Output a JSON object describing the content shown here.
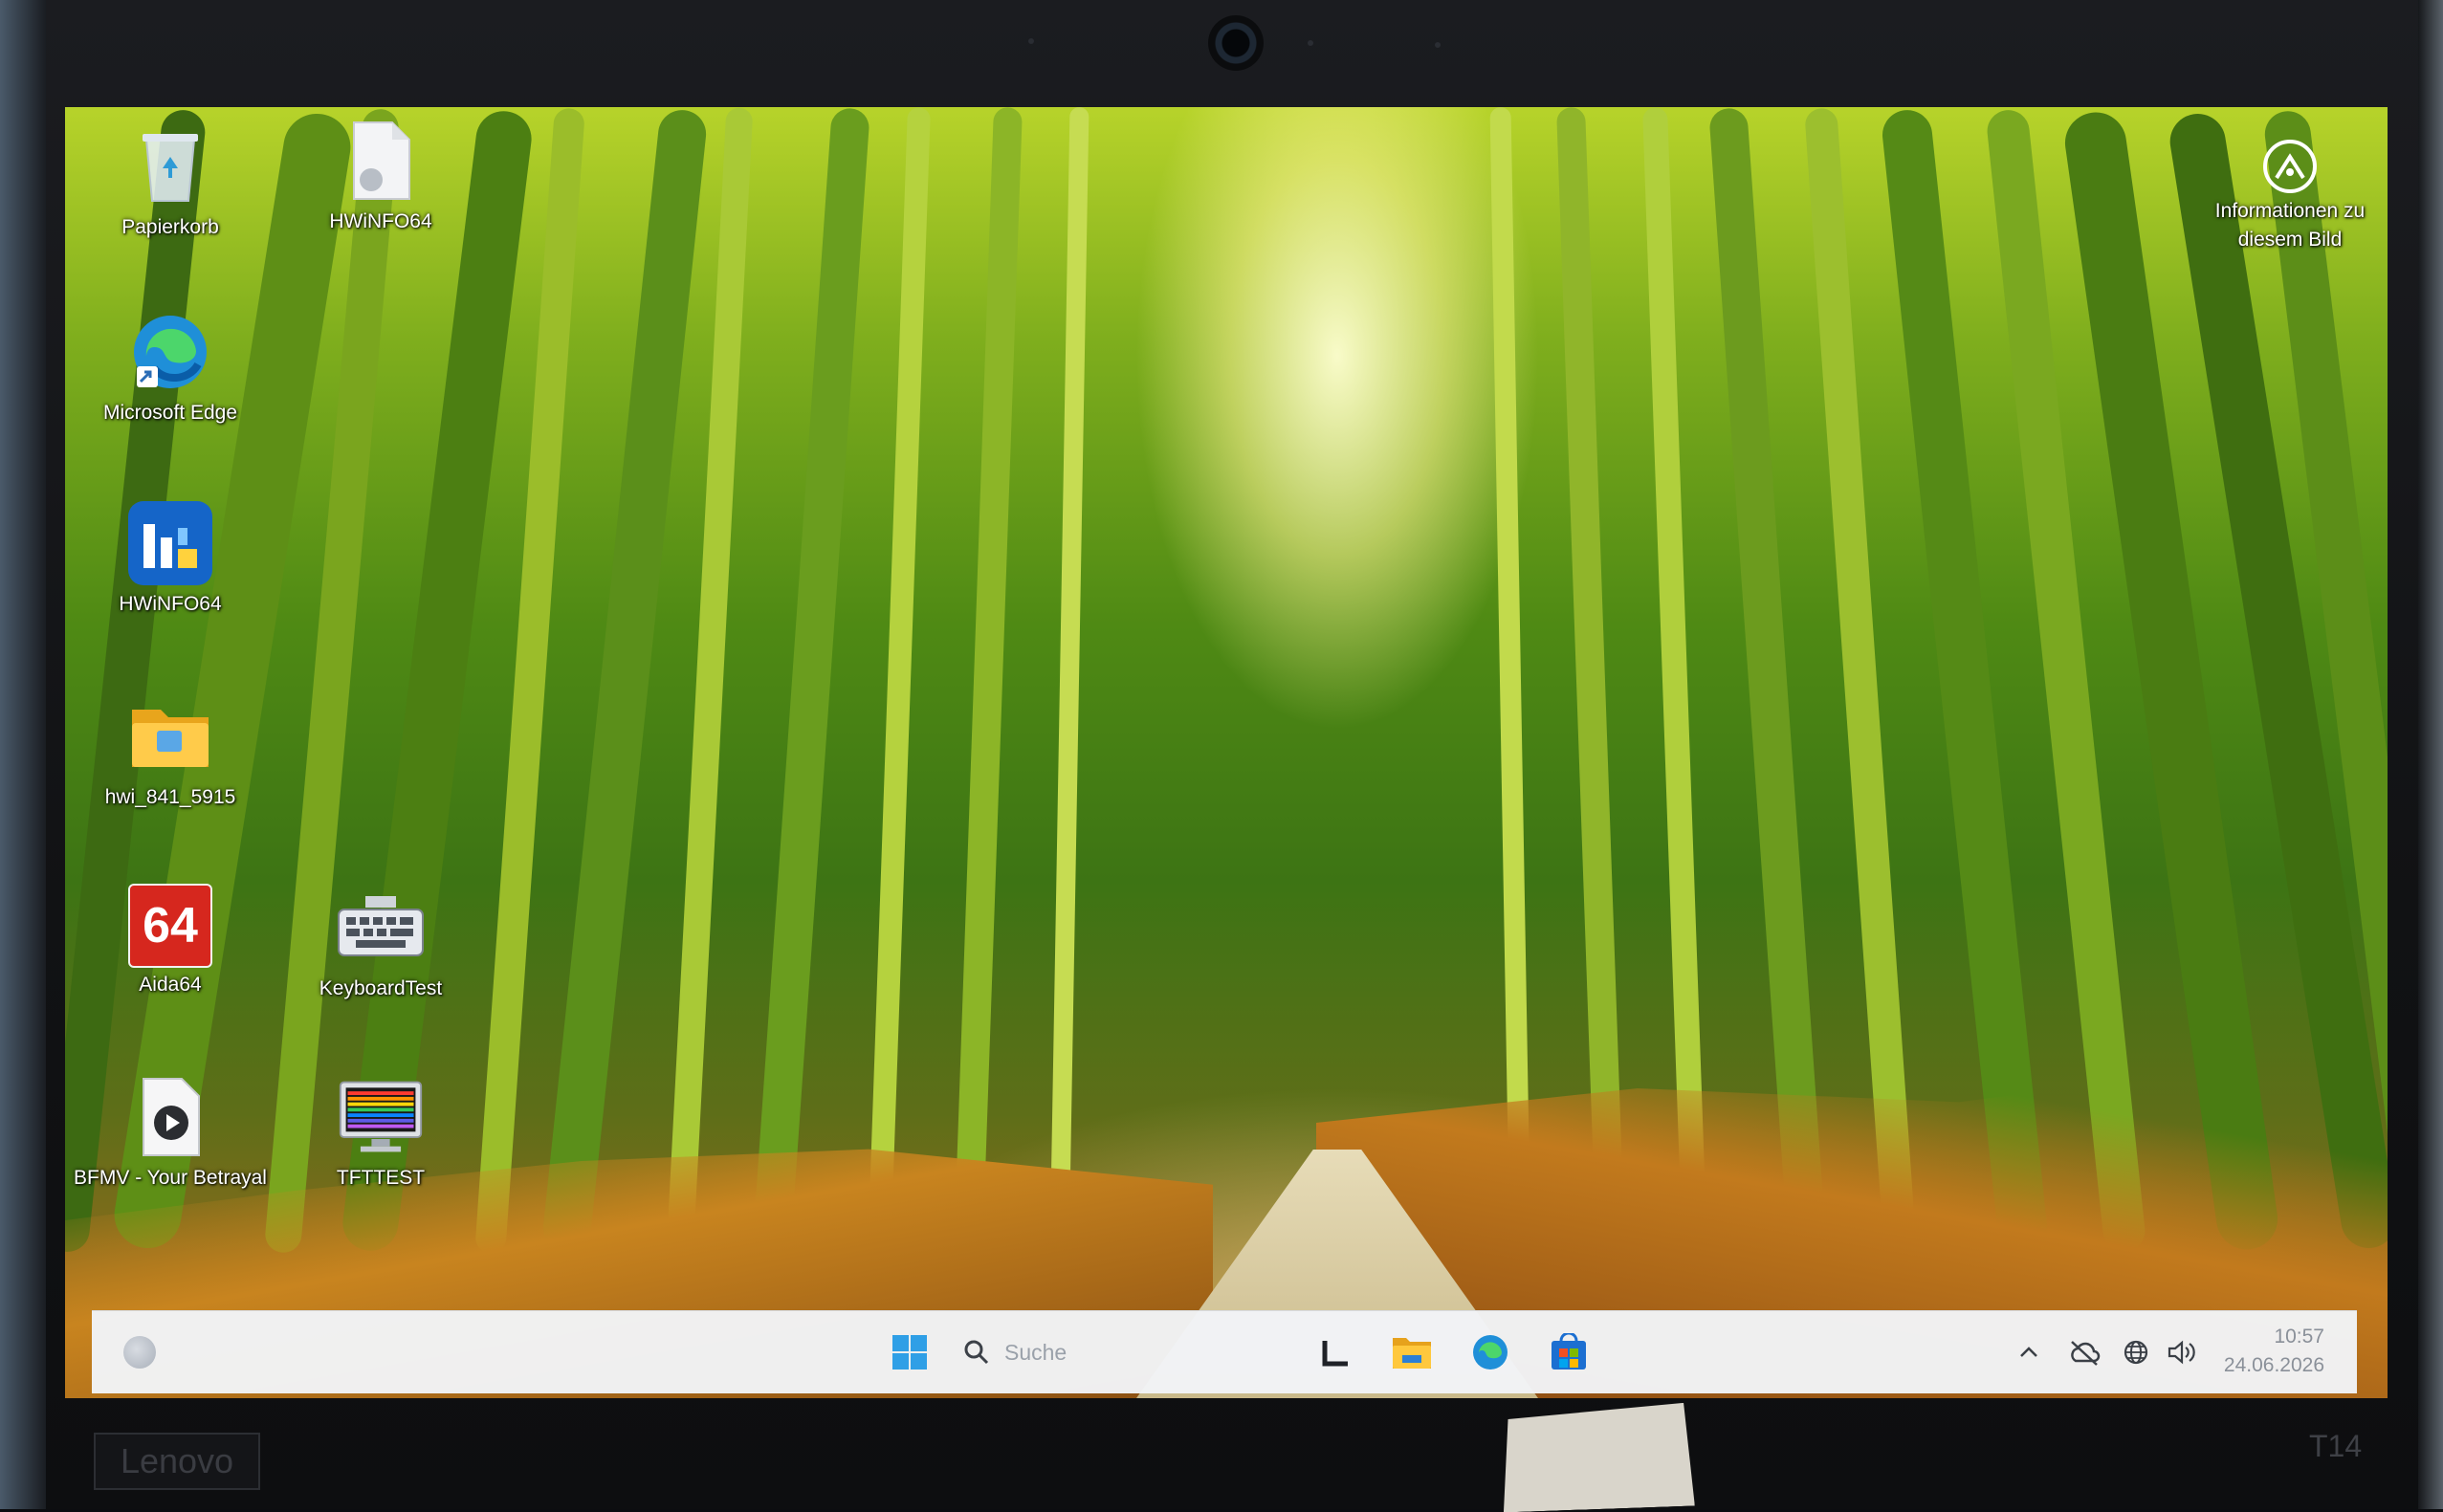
{
  "desktop": {
    "icons": [
      {
        "label": "Papierkorb",
        "icon": "recycle-bin-icon"
      },
      {
        "label": "HWiNFO64",
        "icon": "file-shortcut-icon"
      },
      {
        "label": "Microsoft Edge",
        "icon": "edge-icon"
      },
      {
        "label": "HWiNFO64",
        "icon": "hwinfo-icon"
      },
      {
        "label": "hwi_841_5915",
        "icon": "folder-icon"
      },
      {
        "label": "Aida64",
        "icon": "aida64-icon"
      },
      {
        "label": "KeyboardTest",
        "icon": "keyboard-icon"
      },
      {
        "label": "BFMV - Your Betrayal",
        "icon": "video-file-icon"
      },
      {
        "label": "TFTTEST",
        "icon": "monitor-test-icon"
      }
    ],
    "aida_badge": "64",
    "info_widget": {
      "line1": "Informationen zu",
      "line2": "diesem Bild",
      "icon": "spotlight-info-icon"
    }
  },
  "taskbar": {
    "search_placeholder": "Suche",
    "apps": [
      "widgets-icon",
      "start-icon",
      "task-view-icon",
      "file-explorer-icon",
      "edge-icon",
      "store-icon"
    ],
    "tray": [
      "chevron-up-icon",
      "cloud-offline-icon",
      "network-globe-icon",
      "speaker-icon"
    ],
    "time": "10:57",
    "date": "24.06.2026"
  },
  "laptop": {
    "brand": "Lenovo",
    "model": "T14"
  },
  "colors": {
    "accent": "#0078d4",
    "taskbar": "#f2f4f7",
    "bezel": "#141518"
  }
}
